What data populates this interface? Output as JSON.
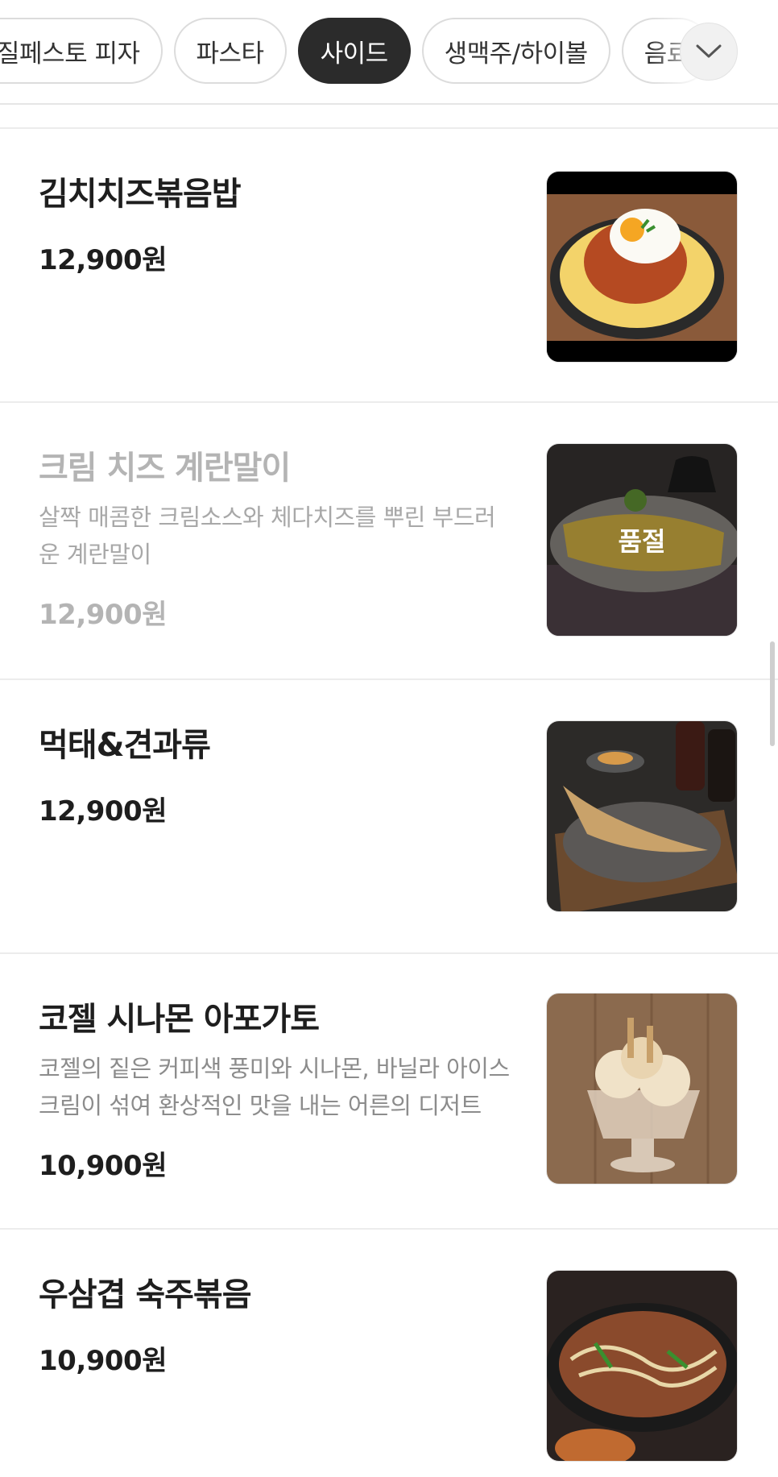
{
  "categories": {
    "tabs": [
      {
        "label": "바질페스토 피자",
        "active": false
      },
      {
        "label": "파스타",
        "active": false
      },
      {
        "label": "사이드",
        "active": true
      },
      {
        "label": "생맥주/하이볼",
        "active": false
      },
      {
        "label": "음료",
        "active": false
      }
    ],
    "expand_icon": "chevron-down-icon"
  },
  "menu": {
    "items": [
      {
        "name": "김치치즈볶음밥",
        "description": "",
        "price": "12,900원",
        "sold_out": false,
        "image": "kimchi-cheese-fried-rice-photo"
      },
      {
        "name": "크림 치즈 계란말이",
        "description": "살짝 매콤한 크림소스와 체다치즈를 뿌린 부드러운 계란말이",
        "price": "12,900원",
        "sold_out": true,
        "sold_out_label": "품절",
        "image": "cream-cheese-rolled-omelette-photo"
      },
      {
        "name": "먹태&견과류",
        "description": "",
        "price": "12,900원",
        "sold_out": false,
        "image": "dried-pollack-and-nuts-photo"
      },
      {
        "name": "코젤 시나몬 아포가토",
        "description": "코젤의 짙은 커피색 풍미와 시나몬, 바닐라 아이스크림이 섞여 환상적인 맛을 내는 어른의 디저트",
        "price": "10,900원",
        "sold_out": false,
        "image": "kozel-cinnamon-affogato-photo"
      },
      {
        "name": "우삼겹 숙주볶음",
        "description": "",
        "price": "10,900원",
        "sold_out": false,
        "image": "beef-brisket-bean-sprout-stirfry-photo"
      }
    ]
  }
}
